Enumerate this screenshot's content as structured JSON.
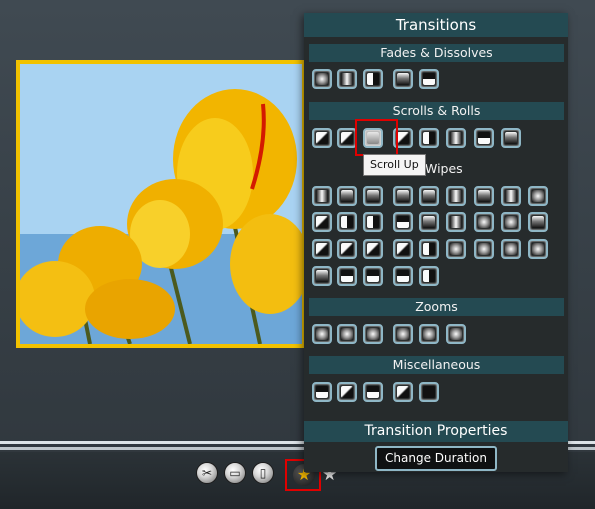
{
  "panel": {
    "title": "Transitions",
    "sections": [
      {
        "label": "Fades & Dissolves"
      },
      {
        "label": "Scrolls & Rolls"
      },
      {
        "label": "Wipes"
      },
      {
        "label": "Zooms"
      },
      {
        "label": "Miscellaneous"
      }
    ],
    "tooltip": "Scroll Up",
    "properties_label": "Transition Properties",
    "change_duration_label": "Change Duration"
  },
  "toolbar": {
    "icons": [
      "scissors-icon",
      "caption-icon",
      "paste-icon",
      "transition-star-icon",
      "effect-star-icon"
    ]
  },
  "colors": {
    "accent": "#244a52",
    "highlight": "#e00000",
    "photo_border": "#f2c200"
  }
}
